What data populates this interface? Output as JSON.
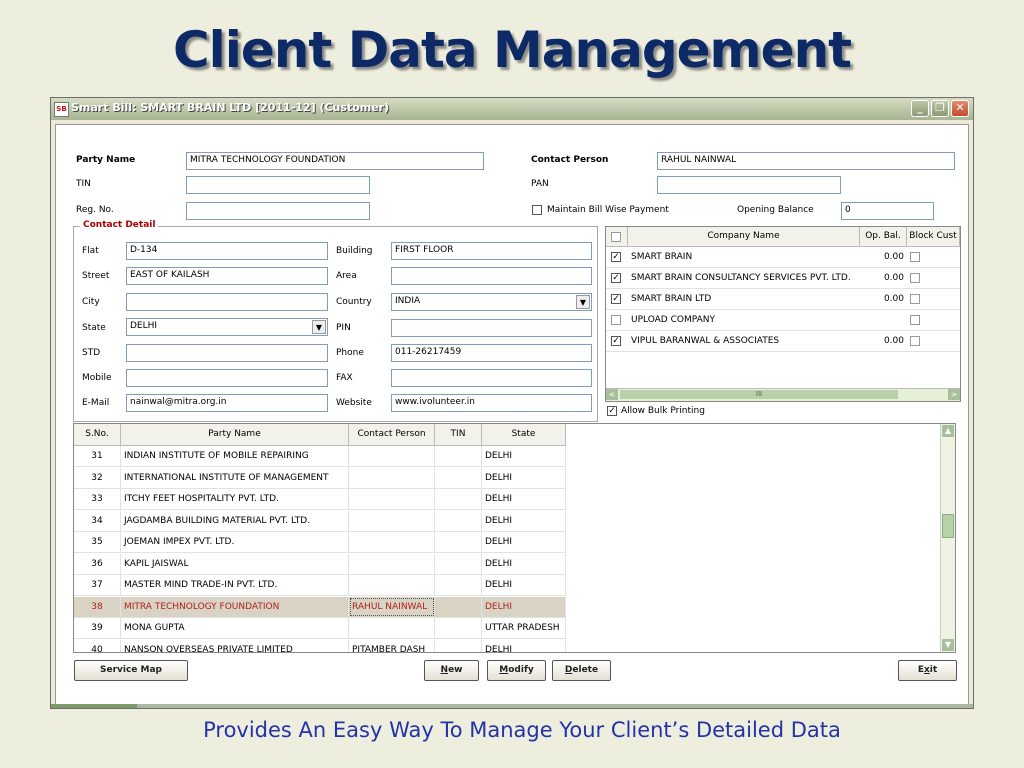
{
  "slide": {
    "title": "Client Data Management",
    "caption": "Provides An Easy Way To Manage Your Client’s Detailed Data"
  },
  "window": {
    "icon_text": "SB",
    "title": "Smart Bill: SMART BRAIN LTD [2011-12]  (Customer)",
    "min_glyph": "_",
    "max_glyph": "❐",
    "close_glyph": "✕"
  },
  "form": {
    "party_name_label": "Party Name",
    "party_name_value": "MITRA TECHNOLOGY FOUNDATION",
    "contact_person_label": "Contact Person",
    "contact_person_value": "RAHUL NAINWAL",
    "tin_label": "TIN",
    "tin_value": "",
    "pan_label": "PAN",
    "pan_value": "",
    "reg_no_label": "Reg. No.",
    "reg_no_value": "",
    "maintain_bill_label": "Maintain Bill Wise Payment",
    "maintain_bill_checked": false,
    "opening_balance_label": "Opening Balance",
    "opening_balance_value": "0"
  },
  "contact_detail": {
    "legend": "Contact Detail",
    "flat_label": "Flat",
    "flat_value": "D-134",
    "building_label": "Building",
    "building_value": "FIRST FLOOR",
    "street_label": "Street",
    "street_value": "EAST OF KAILASH",
    "area_label": "Area",
    "area_value": "",
    "city_label": "City",
    "city_value": "",
    "country_label": "Country",
    "country_value": "INDIA",
    "state_label": "State",
    "state_value": "DELHI",
    "pin_label": "PIN",
    "pin_value": "",
    "std_label": "STD",
    "std_value": "",
    "phone_label": "Phone",
    "phone_value": "011-26217459",
    "mobile_label": "Mobile",
    "mobile_value": "",
    "fax_label": "FAX",
    "fax_value": "",
    "email_label": "E-Mail",
    "email_value": "nainwal@mitra.org.in",
    "website_label": "Website",
    "website_value": "www.ivolunteer.in",
    "dropdown_glyph": "▼"
  },
  "company_grid": {
    "headers": {
      "company": "Company Name",
      "op_bal": "Op. Bal.",
      "block": "Block Cust"
    },
    "rows": [
      {
        "checked": true,
        "name": "SMART BRAIN",
        "op_bal": "0.00",
        "block": false,
        "has_bal": true
      },
      {
        "checked": true,
        "name": "SMART BRAIN CONSULTANCY SERVICES PVT. LTD.",
        "op_bal": "0.00",
        "block": false,
        "has_bal": true
      },
      {
        "checked": true,
        "name": "SMART BRAIN LTD",
        "op_bal": "0.00",
        "block": false,
        "has_bal": true
      },
      {
        "checked": false,
        "name": "UPLOAD COMPANY",
        "op_bal": "",
        "block": false,
        "has_bal": false
      },
      {
        "checked": true,
        "name": "VIPUL BARANWAL & ASSOCIATES",
        "op_bal": "0.00",
        "block": false,
        "has_bal": true
      }
    ],
    "scroll_left": "<",
    "scroll_right": ">",
    "scroll_grip": "III",
    "allow_bulk_label": "Allow Bulk Printing",
    "allow_bulk_checked": true
  },
  "party_table": {
    "headers": {
      "sno": "S.No.",
      "party": "Party Name",
      "contact": "Contact Person",
      "tin": "TIN",
      "state": "State"
    },
    "rows": [
      {
        "sno": "31",
        "party": "INDIAN INSTITUTE OF MOBILE REPAIRING",
        "contact": "",
        "tin": "",
        "state": "DELHI",
        "selected": false
      },
      {
        "sno": "32",
        "party": "INTERNATIONAL INSTITUTE OF MANAGEMENT",
        "contact": "",
        "tin": "",
        "state": "DELHI",
        "selected": false
      },
      {
        "sno": "33",
        "party": "ITCHY FEET HOSPITALITY PVT. LTD.",
        "contact": "",
        "tin": "",
        "state": "DELHI",
        "selected": false
      },
      {
        "sno": "34",
        "party": "JAGDAMBA BUILDING MATERIAL PVT. LTD.",
        "contact": "",
        "tin": "",
        "state": "DELHI",
        "selected": false
      },
      {
        "sno": "35",
        "party": "JOEMAN IMPEX PVT. LTD.",
        "contact": "",
        "tin": "",
        "state": "DELHI",
        "selected": false
      },
      {
        "sno": "36",
        "party": "KAPIL JAISWAL",
        "contact": "",
        "tin": "",
        "state": "DELHI",
        "selected": false
      },
      {
        "sno": "37",
        "party": "MASTER MIND TRADE-IN PVT. LTD.",
        "contact": "",
        "tin": "",
        "state": "DELHI",
        "selected": false
      },
      {
        "sno": "38",
        "party": "MITRA TECHNOLOGY FOUNDATION",
        "contact": "RAHUL NAINWAL",
        "tin": "",
        "state": "DELHI",
        "selected": true
      },
      {
        "sno": "39",
        "party": "MONA GUPTA",
        "contact": "",
        "tin": "",
        "state": "UTTAR PRADESH",
        "selected": false
      },
      {
        "sno": "40",
        "party": "NANSON OVERSEAS PRIVATE LIMITED",
        "contact": "PITAMBER DASH",
        "tin": "",
        "state": "DELHI",
        "selected": false
      }
    ],
    "scroll_up": "▲",
    "scroll_down": "▼"
  },
  "buttons": {
    "service_map": "Service Map",
    "new_u": "N",
    "new_rest": "ew",
    "modify_u": "M",
    "modify_rest": "odify",
    "delete_u": "D",
    "delete_rest": "elete",
    "exit_pre": "E",
    "exit_u": "x",
    "exit_rest": "it"
  },
  "colors": {
    "title": "#0e2a66",
    "caption": "#2432a8",
    "selected_row_bg": "#d9d3c3",
    "selected_row_text": "#b02020",
    "contact_legend": "#aa0000"
  }
}
